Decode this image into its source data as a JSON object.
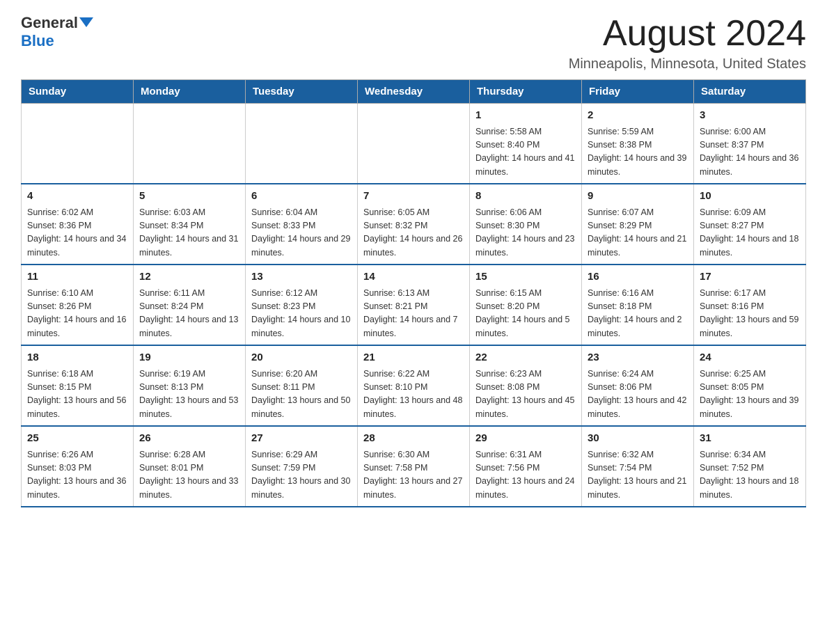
{
  "header": {
    "logo_general": "General",
    "logo_blue": "Blue",
    "month_year": "August 2024",
    "location": "Minneapolis, Minnesota, United States"
  },
  "weekdays": [
    "Sunday",
    "Monday",
    "Tuesday",
    "Wednesday",
    "Thursday",
    "Friday",
    "Saturday"
  ],
  "weeks": [
    [
      {
        "day": "",
        "info": ""
      },
      {
        "day": "",
        "info": ""
      },
      {
        "day": "",
        "info": ""
      },
      {
        "day": "",
        "info": ""
      },
      {
        "day": "1",
        "info": "Sunrise: 5:58 AM\nSunset: 8:40 PM\nDaylight: 14 hours and 41 minutes."
      },
      {
        "day": "2",
        "info": "Sunrise: 5:59 AM\nSunset: 8:38 PM\nDaylight: 14 hours and 39 minutes."
      },
      {
        "day": "3",
        "info": "Sunrise: 6:00 AM\nSunset: 8:37 PM\nDaylight: 14 hours and 36 minutes."
      }
    ],
    [
      {
        "day": "4",
        "info": "Sunrise: 6:02 AM\nSunset: 8:36 PM\nDaylight: 14 hours and 34 minutes."
      },
      {
        "day": "5",
        "info": "Sunrise: 6:03 AM\nSunset: 8:34 PM\nDaylight: 14 hours and 31 minutes."
      },
      {
        "day": "6",
        "info": "Sunrise: 6:04 AM\nSunset: 8:33 PM\nDaylight: 14 hours and 29 minutes."
      },
      {
        "day": "7",
        "info": "Sunrise: 6:05 AM\nSunset: 8:32 PM\nDaylight: 14 hours and 26 minutes."
      },
      {
        "day": "8",
        "info": "Sunrise: 6:06 AM\nSunset: 8:30 PM\nDaylight: 14 hours and 23 minutes."
      },
      {
        "day": "9",
        "info": "Sunrise: 6:07 AM\nSunset: 8:29 PM\nDaylight: 14 hours and 21 minutes."
      },
      {
        "day": "10",
        "info": "Sunrise: 6:09 AM\nSunset: 8:27 PM\nDaylight: 14 hours and 18 minutes."
      }
    ],
    [
      {
        "day": "11",
        "info": "Sunrise: 6:10 AM\nSunset: 8:26 PM\nDaylight: 14 hours and 16 minutes."
      },
      {
        "day": "12",
        "info": "Sunrise: 6:11 AM\nSunset: 8:24 PM\nDaylight: 14 hours and 13 minutes."
      },
      {
        "day": "13",
        "info": "Sunrise: 6:12 AM\nSunset: 8:23 PM\nDaylight: 14 hours and 10 minutes."
      },
      {
        "day": "14",
        "info": "Sunrise: 6:13 AM\nSunset: 8:21 PM\nDaylight: 14 hours and 7 minutes."
      },
      {
        "day": "15",
        "info": "Sunrise: 6:15 AM\nSunset: 8:20 PM\nDaylight: 14 hours and 5 minutes."
      },
      {
        "day": "16",
        "info": "Sunrise: 6:16 AM\nSunset: 8:18 PM\nDaylight: 14 hours and 2 minutes."
      },
      {
        "day": "17",
        "info": "Sunrise: 6:17 AM\nSunset: 8:16 PM\nDaylight: 13 hours and 59 minutes."
      }
    ],
    [
      {
        "day": "18",
        "info": "Sunrise: 6:18 AM\nSunset: 8:15 PM\nDaylight: 13 hours and 56 minutes."
      },
      {
        "day": "19",
        "info": "Sunrise: 6:19 AM\nSunset: 8:13 PM\nDaylight: 13 hours and 53 minutes."
      },
      {
        "day": "20",
        "info": "Sunrise: 6:20 AM\nSunset: 8:11 PM\nDaylight: 13 hours and 50 minutes."
      },
      {
        "day": "21",
        "info": "Sunrise: 6:22 AM\nSunset: 8:10 PM\nDaylight: 13 hours and 48 minutes."
      },
      {
        "day": "22",
        "info": "Sunrise: 6:23 AM\nSunset: 8:08 PM\nDaylight: 13 hours and 45 minutes."
      },
      {
        "day": "23",
        "info": "Sunrise: 6:24 AM\nSunset: 8:06 PM\nDaylight: 13 hours and 42 minutes."
      },
      {
        "day": "24",
        "info": "Sunrise: 6:25 AM\nSunset: 8:05 PM\nDaylight: 13 hours and 39 minutes."
      }
    ],
    [
      {
        "day": "25",
        "info": "Sunrise: 6:26 AM\nSunset: 8:03 PM\nDaylight: 13 hours and 36 minutes."
      },
      {
        "day": "26",
        "info": "Sunrise: 6:28 AM\nSunset: 8:01 PM\nDaylight: 13 hours and 33 minutes."
      },
      {
        "day": "27",
        "info": "Sunrise: 6:29 AM\nSunset: 7:59 PM\nDaylight: 13 hours and 30 minutes."
      },
      {
        "day": "28",
        "info": "Sunrise: 6:30 AM\nSunset: 7:58 PM\nDaylight: 13 hours and 27 minutes."
      },
      {
        "day": "29",
        "info": "Sunrise: 6:31 AM\nSunset: 7:56 PM\nDaylight: 13 hours and 24 minutes."
      },
      {
        "day": "30",
        "info": "Sunrise: 6:32 AM\nSunset: 7:54 PM\nDaylight: 13 hours and 21 minutes."
      },
      {
        "day": "31",
        "info": "Sunrise: 6:34 AM\nSunset: 7:52 PM\nDaylight: 13 hours and 18 minutes."
      }
    ]
  ]
}
